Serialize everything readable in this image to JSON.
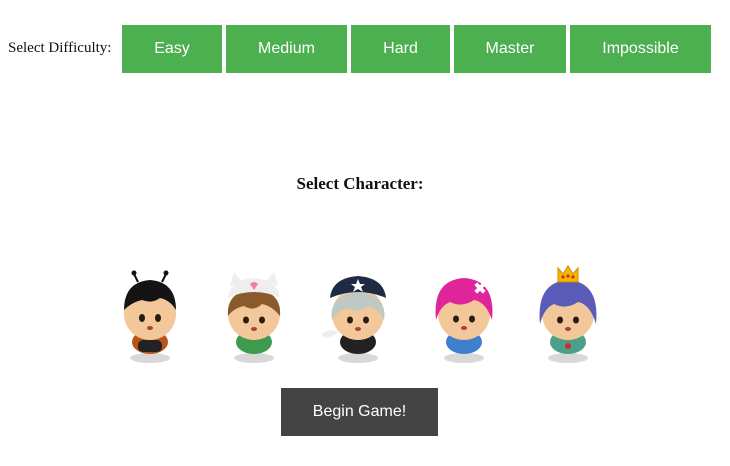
{
  "difficulty": {
    "label": "Select Difficulty:",
    "options": [
      "Easy",
      "Medium",
      "Hard",
      "Master",
      "Impossible"
    ],
    "button_color": "#4caf50"
  },
  "character_select": {
    "title": "Select Character:",
    "characters": [
      {
        "icon": "boy-black-hair-antennae-icon"
      },
      {
        "icon": "girl-cat-hat-icon"
      },
      {
        "icon": "pirate-girl-hat-icon"
      },
      {
        "icon": "pink-hair-girl-icon"
      },
      {
        "icon": "princess-crown-icon"
      }
    ]
  },
  "begin_button": {
    "label": "Begin Game!",
    "color": "#444444"
  }
}
